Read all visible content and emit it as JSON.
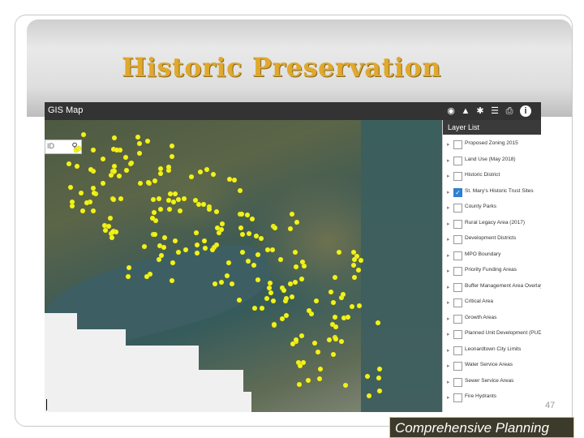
{
  "slide": {
    "title": "Historic Preservation",
    "page_number": "47",
    "footer": "Comprehensive Planning"
  },
  "app": {
    "title": "GIS Map",
    "search": {
      "value": "ID"
    },
    "header_icons": [
      "layers-icon",
      "graduation-cap-icon",
      "basemap-icon",
      "layer-list-icon",
      "print-icon",
      "info-icon"
    ],
    "accent_color": "#f2f21a"
  },
  "layer_list": {
    "title": "Layer List",
    "layers": [
      {
        "label": "Proposed Zoning 2015",
        "checked": false
      },
      {
        "label": "Land Use (May 2018)",
        "checked": false
      },
      {
        "label": "Historic District",
        "checked": false
      },
      {
        "label": "St. Mary's Historic Trust Sites",
        "checked": true
      },
      {
        "label": "County Parks",
        "checked": false
      },
      {
        "label": "Rural Legacy Area (2017)",
        "checked": false
      },
      {
        "label": "Development Districts",
        "checked": false
      },
      {
        "label": "MPO Boundary",
        "checked": false
      },
      {
        "label": "Priority Funding Areas",
        "checked": false
      },
      {
        "label": "Buffer Management Area Overlay",
        "checked": false
      },
      {
        "label": "Critical Area",
        "checked": false
      },
      {
        "label": "Growth Areas",
        "checked": false
      },
      {
        "label": "Planned Unit Development (PUD)",
        "checked": false
      },
      {
        "label": "Leonardtown City Limits",
        "checked": false
      },
      {
        "label": "Water Service Areas",
        "checked": false
      },
      {
        "label": "Sewer Service Areas",
        "checked": false
      },
      {
        "label": "Fire Hydrants",
        "checked": false
      }
    ]
  }
}
